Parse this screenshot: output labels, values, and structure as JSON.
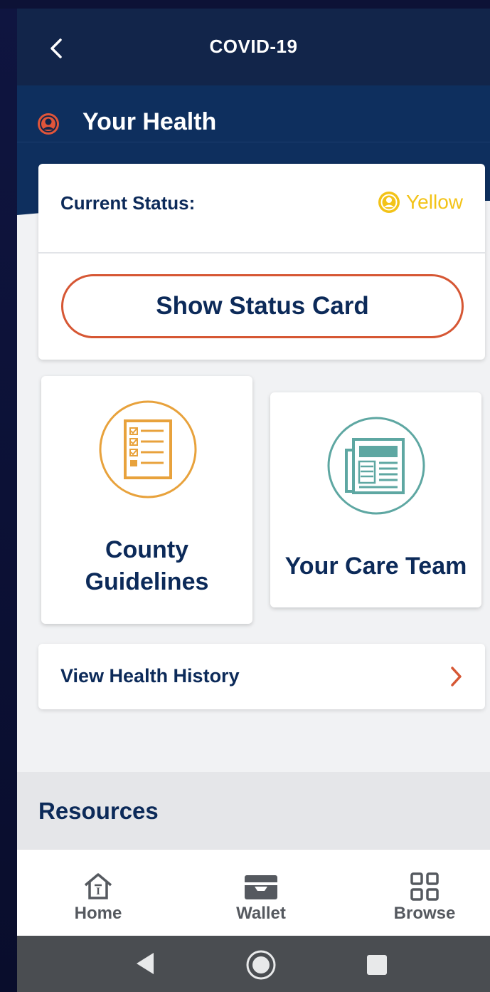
{
  "appbar": {
    "title": "COVID-19",
    "back_icon": "chevron-left-icon"
  },
  "health": {
    "title": "Your Health",
    "icon": "user-circle-icon"
  },
  "status_card": {
    "label": "Current Status:",
    "value": "Yellow",
    "value_color": "#f3c318",
    "button_label": "Show Status Card",
    "button_border_color": "#d65734"
  },
  "tiles": [
    {
      "label": "County Guidelines",
      "icon": "checklist-icon",
      "icon_color": "#e8a23c"
    },
    {
      "label": "Your Care Team",
      "icon": "newspaper-icon",
      "icon_color": "#5ea7a2"
    }
  ],
  "history": {
    "label": "View Health History",
    "chevron_color": "#d65734"
  },
  "resources": {
    "title": "Resources"
  },
  "bottom_nav": [
    {
      "label": "Home",
      "icon": "home-icon"
    },
    {
      "label": "Wallet",
      "icon": "wallet-icon"
    },
    {
      "label": "Browse",
      "icon": "grid-icon"
    }
  ],
  "colors": {
    "navy_text": "#0c2a59",
    "header_bg": "#12254a",
    "band_bg": "#0e2f5e"
  }
}
